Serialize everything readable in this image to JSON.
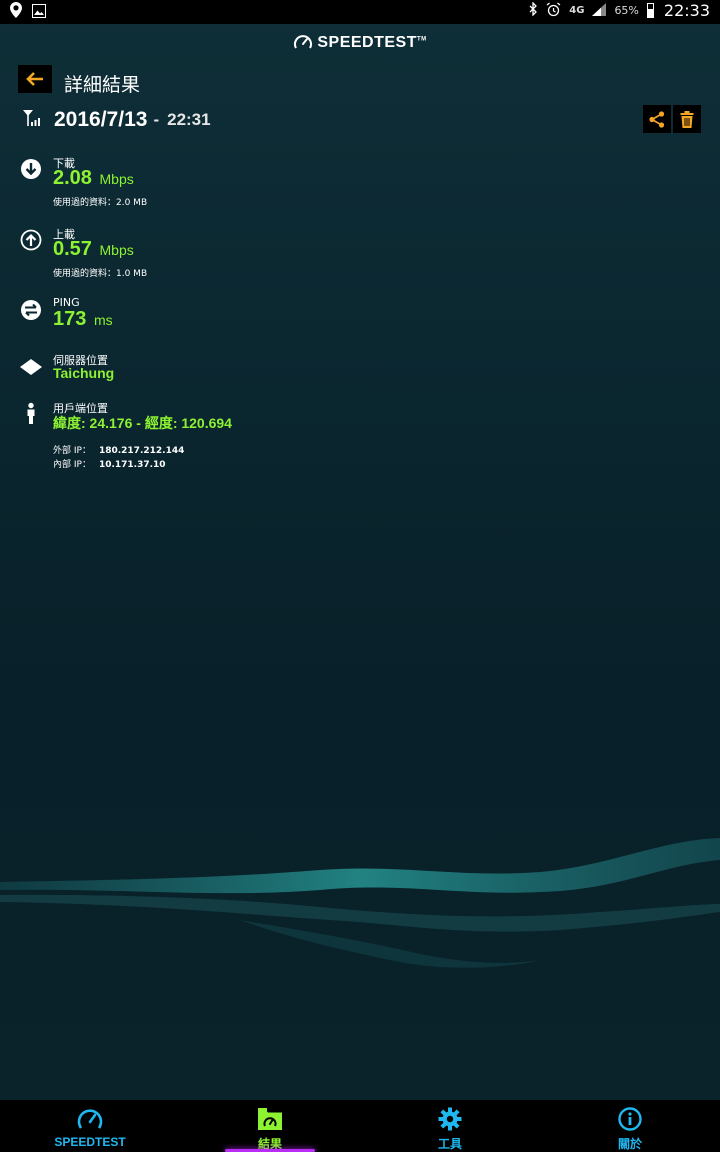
{
  "status_bar": {
    "battery": "65%",
    "network": "4G",
    "time": "22:33"
  },
  "brand": "SPEEDTEST",
  "page_title": "詳細結果",
  "result": {
    "date": "2016/7/13",
    "separator": "-",
    "time": "22:31"
  },
  "download": {
    "label": "下載",
    "value": "2.08",
    "unit": "Mbps",
    "data_used": "使用過的資料：2.0 MB"
  },
  "upload": {
    "label": "上載",
    "value": "0.57",
    "unit": "Mbps",
    "data_used": "使用過的資料：1.0 MB"
  },
  "ping": {
    "label": "PING",
    "value": "173",
    "unit": "ms"
  },
  "server": {
    "label": "伺服器位置",
    "value": "Taichung"
  },
  "client": {
    "label": "用戶端位置",
    "coords": "緯度: 24.176 - 經度: 120.694",
    "external_ip_label": "外部 IP：",
    "external_ip": "180.217.212.144",
    "internal_ip_label": "內部 IP：",
    "internal_ip": "10.171.37.10"
  },
  "nav": {
    "items": [
      {
        "label": "SPEEDTEST",
        "active": false
      },
      {
        "label": "結果",
        "active": true
      },
      {
        "label": "工具",
        "active": false
      },
      {
        "label": "關於",
        "active": false
      }
    ]
  },
  "colors": {
    "accent_green": "#8cf231",
    "accent_orange": "#f5a623",
    "accent_cyan": "#1fb8f0",
    "active_underline": "#b82cf5"
  }
}
